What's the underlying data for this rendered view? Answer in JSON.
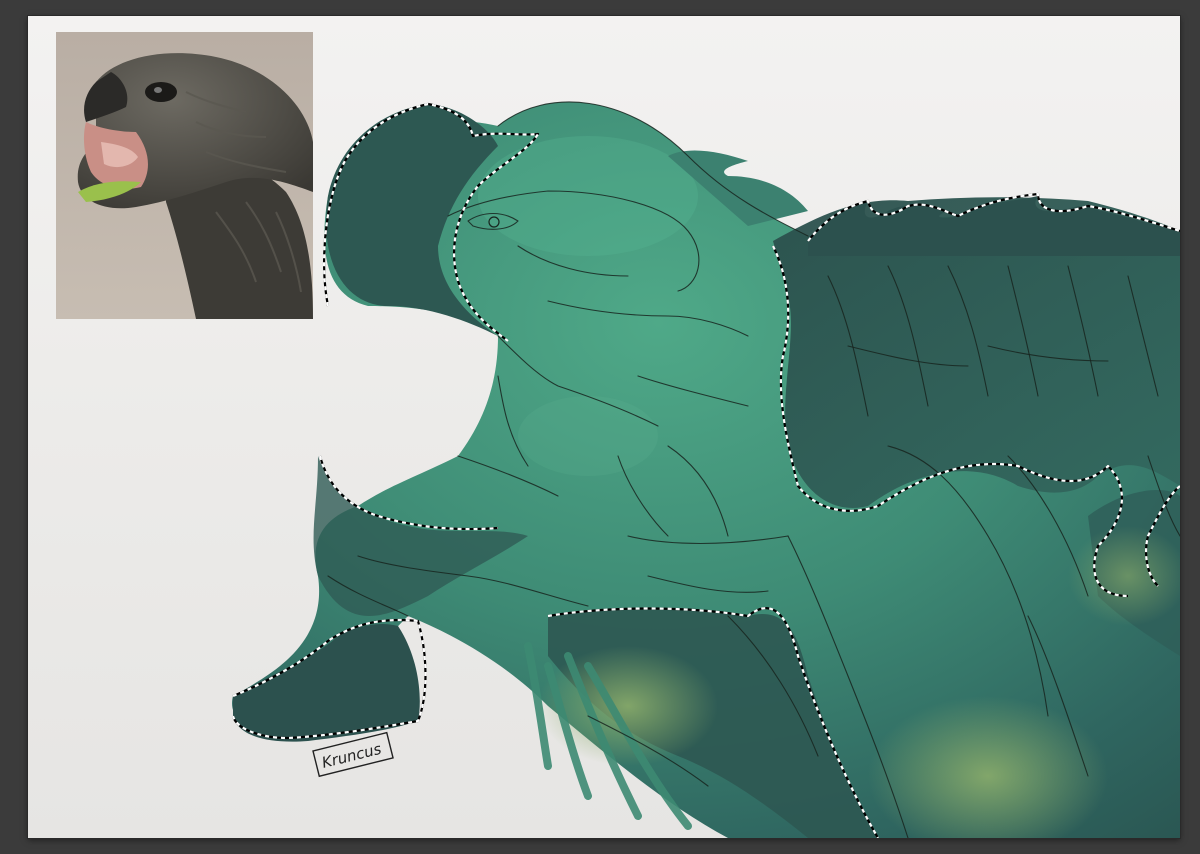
{
  "app": {
    "view": "canvas",
    "background_color": "#3b3b3b"
  },
  "canvas": {
    "paper_color": "#f0efed",
    "fill_colors": {
      "teal_light": "#4aa283",
      "teal_mid": "#3f8a75",
      "teal_dark": "#2e5b54",
      "olive": "#7fa468"
    }
  },
  "reference_photo": {
    "subject": "tortoise-head-open-mouth",
    "icon": "reference-image"
  },
  "signature": {
    "text": "Kruncus"
  },
  "selection": {
    "style": "marching-ants"
  }
}
